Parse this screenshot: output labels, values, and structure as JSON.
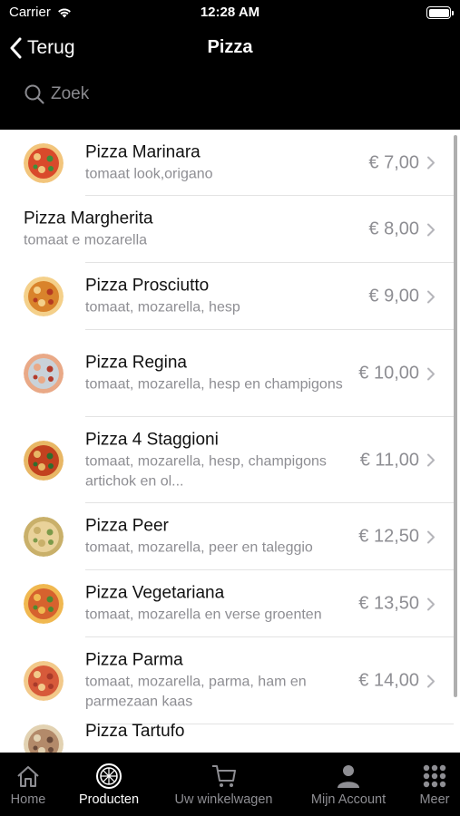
{
  "status_bar": {
    "carrier": "Carrier",
    "time": "12:28 AM"
  },
  "nav": {
    "back_label": "Terug",
    "title": "Pizza"
  },
  "search": {
    "placeholder": "Zoek"
  },
  "products": [
    {
      "name": "Pizza Marinara",
      "description": "tomaat look,origano",
      "price": "€ 7,00",
      "has_image": true,
      "image": "margherita-thumb"
    },
    {
      "name": "Pizza Margherita",
      "description": "tomaat e mozarella",
      "price": "€ 8,00",
      "has_image": false
    },
    {
      "name": "Pizza Prosciutto",
      "description": "tomaat, mozarella, hesp",
      "price": "€ 9,00",
      "has_image": true,
      "image": "prosciutto-thumb"
    },
    {
      "name": "Pizza Regina",
      "description": "tomaat, mozarella, hesp en champigons",
      "price": "€ 10,00",
      "has_image": true,
      "image": "regina-thumb"
    },
    {
      "name": "Pizza 4 Staggioni",
      "description": "tomaat, mozarella, hesp, champigons artichok en ol...",
      "price": "€ 11,00",
      "has_image": true,
      "image": "staggioni-thumb"
    },
    {
      "name": "Pizza Peer",
      "description": "tomaat, mozarella, peer en taleggio",
      "price": "€ 12,50",
      "has_image": true,
      "image": "peer-thumb"
    },
    {
      "name": "Pizza Vegetariana",
      "description": "tomaat, mozarella en verse groenten",
      "price": "€ 13,50",
      "has_image": true,
      "image": "vegetariana-thumb"
    },
    {
      "name": "Pizza Parma",
      "description": "tomaat, mozarella, parma, ham en parmezaan kaas",
      "price": "€ 14,00",
      "has_image": true,
      "image": "parma-thumb"
    },
    {
      "name": "Pizza Tartufo",
      "description": "",
      "price": "",
      "has_image": true,
      "image": "tartufo-thumb"
    }
  ],
  "tabs": [
    {
      "label": "Home",
      "icon": "home-icon",
      "active": false
    },
    {
      "label": "Producten",
      "icon": "pizza-icon",
      "active": true
    },
    {
      "label": "Uw winkelwagen",
      "icon": "cart-icon",
      "active": false
    },
    {
      "label": "Mijn Account",
      "icon": "person-icon",
      "active": false
    },
    {
      "label": "Meer",
      "icon": "grid-icon",
      "active": false
    }
  ],
  "colors": {
    "bar_background": "#000000",
    "secondary_text": "#8e8e93",
    "separator": "#e3e3e3"
  }
}
